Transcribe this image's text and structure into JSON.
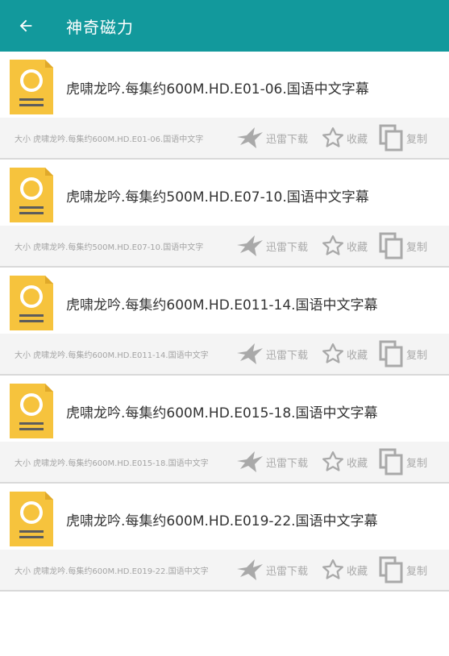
{
  "appbar": {
    "title": "神奇磁力"
  },
  "items": [
    {
      "title": "虎啸龙吟.每集约600M.HD.E01-06.国语中文字幕",
      "size": "大小  虎啸龙吟.每集约600M.HD.E01-06.国语中文字",
      "thunder_label": "迅雷下载",
      "fav_label": "收藏",
      "copy_label": "复制"
    },
    {
      "title": "虎啸龙吟.每集约500M.HD.E07-10.国语中文字幕",
      "size": "大小  虎啸龙吟.每集约500M.HD.E07-10.国语中文字",
      "thunder_label": "迅雷下载",
      "fav_label": "收藏",
      "copy_label": "复制"
    },
    {
      "title": "虎啸龙吟.每集约600M.HD.E011-14.国语中文字幕",
      "size": "大小  虎啸龙吟.每集约600M.HD.E011-14.国语中文字",
      "thunder_label": "迅雷下载",
      "fav_label": "收藏",
      "copy_label": "复制"
    },
    {
      "title": "虎啸龙吟.每集约600M.HD.E015-18.国语中文字幕",
      "size": "大小  虎啸龙吟.每集约600M.HD.E015-18.国语中文字",
      "thunder_label": "迅雷下载",
      "fav_label": "收藏",
      "copy_label": "复制"
    },
    {
      "title": "虎啸龙吟.每集约600M.HD.E019-22.国语中文字幕",
      "size": "大小  虎啸龙吟.每集约600M.HD.E019-22.国语中文字",
      "thunder_label": "迅雷下载",
      "fav_label": "收藏",
      "copy_label": "复制"
    }
  ],
  "colors": {
    "appbar": "#12999c",
    "file_icon": "#f6c33d",
    "action_gray": "#a9a9a9"
  },
  "icons": {
    "back": "arrow-left-icon",
    "file": "file-icon",
    "thunder": "thunder-bird-icon",
    "fav": "star-outline-icon",
    "copy": "copy-icon"
  }
}
